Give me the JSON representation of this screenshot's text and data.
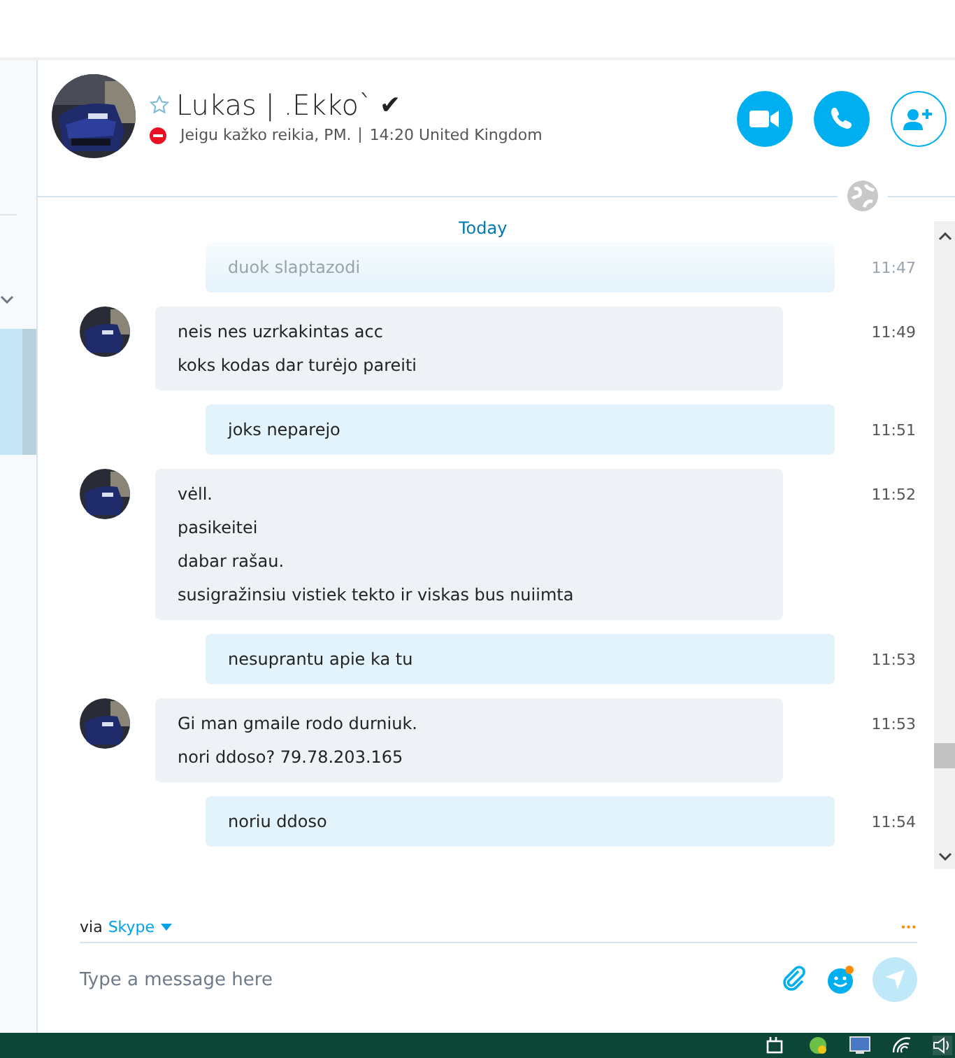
{
  "contact": {
    "name": "Lukas | .Ekko`",
    "verified_mark": "✔",
    "mood": "Jeigu kažko reikia, PM.",
    "local_time": "14:20 United Kingdom"
  },
  "date_separator": "Today",
  "messages": [
    {
      "kind": "outgoing",
      "lines": [
        "duok slaptazodi"
      ],
      "time": "11:47",
      "faded": true
    },
    {
      "kind": "incoming",
      "lines": [
        "neis nes uzrkakintas acc",
        "koks kodas dar turėjo pareiti"
      ],
      "time": "11:49",
      "faded": false
    },
    {
      "kind": "outgoing",
      "lines": [
        "joks neparejo"
      ],
      "time": "11:51",
      "faded": false
    },
    {
      "kind": "incoming",
      "lines": [
        "vėll.",
        "pasikeitei",
        "dabar rašau.",
        "susigražinsiu vistiek tekto ir viskas bus nuiimta"
      ],
      "time": "11:52",
      "faded": false
    },
    {
      "kind": "outgoing",
      "lines": [
        "nesuprantu apie ka tu"
      ],
      "time": "11:53",
      "faded": false
    },
    {
      "kind": "incoming",
      "lines": [
        "Gi man gmaile rodo durniuk.",
        "nori ddoso? 79.78.203.165"
      ],
      "time": "11:53",
      "faded": false
    },
    {
      "kind": "outgoing",
      "lines": [
        "noriu ddoso"
      ],
      "time": "11:54",
      "faded": false
    }
  ],
  "composer": {
    "via": "via",
    "service": "Skype",
    "placeholder": "Type a message here",
    "more": "•••",
    "emoji_badge": true
  }
}
